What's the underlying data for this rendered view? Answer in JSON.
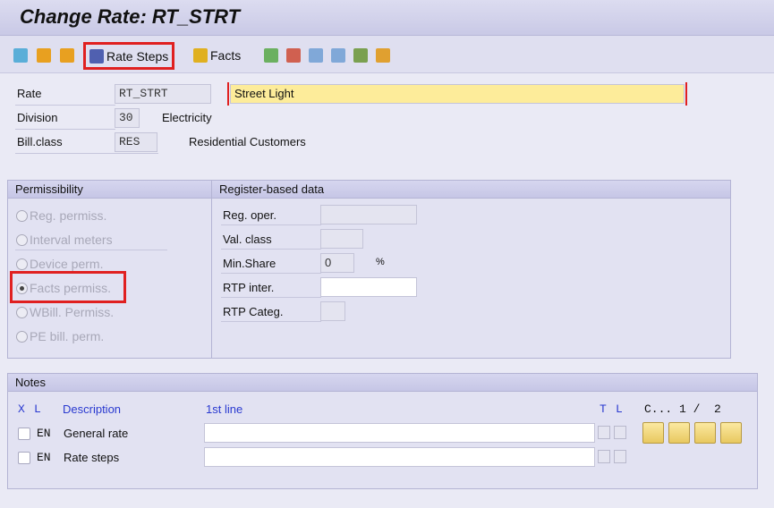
{
  "window": {
    "title": "Change Rate: RT_STRT"
  },
  "toolbar": {
    "rate_steps": "Rate Steps",
    "facts": "Facts"
  },
  "header": {
    "rate_label": "Rate",
    "rate_value": "RT_STRT",
    "rate_text": "Street Light",
    "division_label": "Division",
    "division_value": "30",
    "division_text": "Electricity",
    "billclass_label": "Bill.class",
    "billclass_value": "RES",
    "billclass_text": "Residential Customers"
  },
  "permissibility": {
    "title": "Permissibility",
    "options": [
      "Reg. permiss.",
      "Interval meters",
      "Device perm.",
      "Facts permiss.",
      "WBill. Permiss.",
      "PE bill. perm."
    ],
    "selected": "Facts permiss."
  },
  "register": {
    "title": "Register-based data",
    "reg_oper": "Reg. oper.",
    "val_class": "Val. class",
    "min_share": "Min.Share",
    "min_share_value": "0",
    "min_share_unit": "%",
    "rtp_inter": "RTP inter.",
    "rtp_categ": "RTP Categ."
  },
  "notes": {
    "title": "Notes",
    "col_x": "X",
    "col_l": "L",
    "col_desc": "Description",
    "col_first": "1st line",
    "col_t": "T",
    "col_l2": "L",
    "pager": "C... 1 /  2",
    "rows": [
      {
        "lang": "EN",
        "desc": "General rate"
      },
      {
        "lang": "EN",
        "desc": "Rate steps"
      }
    ]
  },
  "colors": {
    "highlight": "#e02020",
    "required_field": "#fdec9a"
  }
}
